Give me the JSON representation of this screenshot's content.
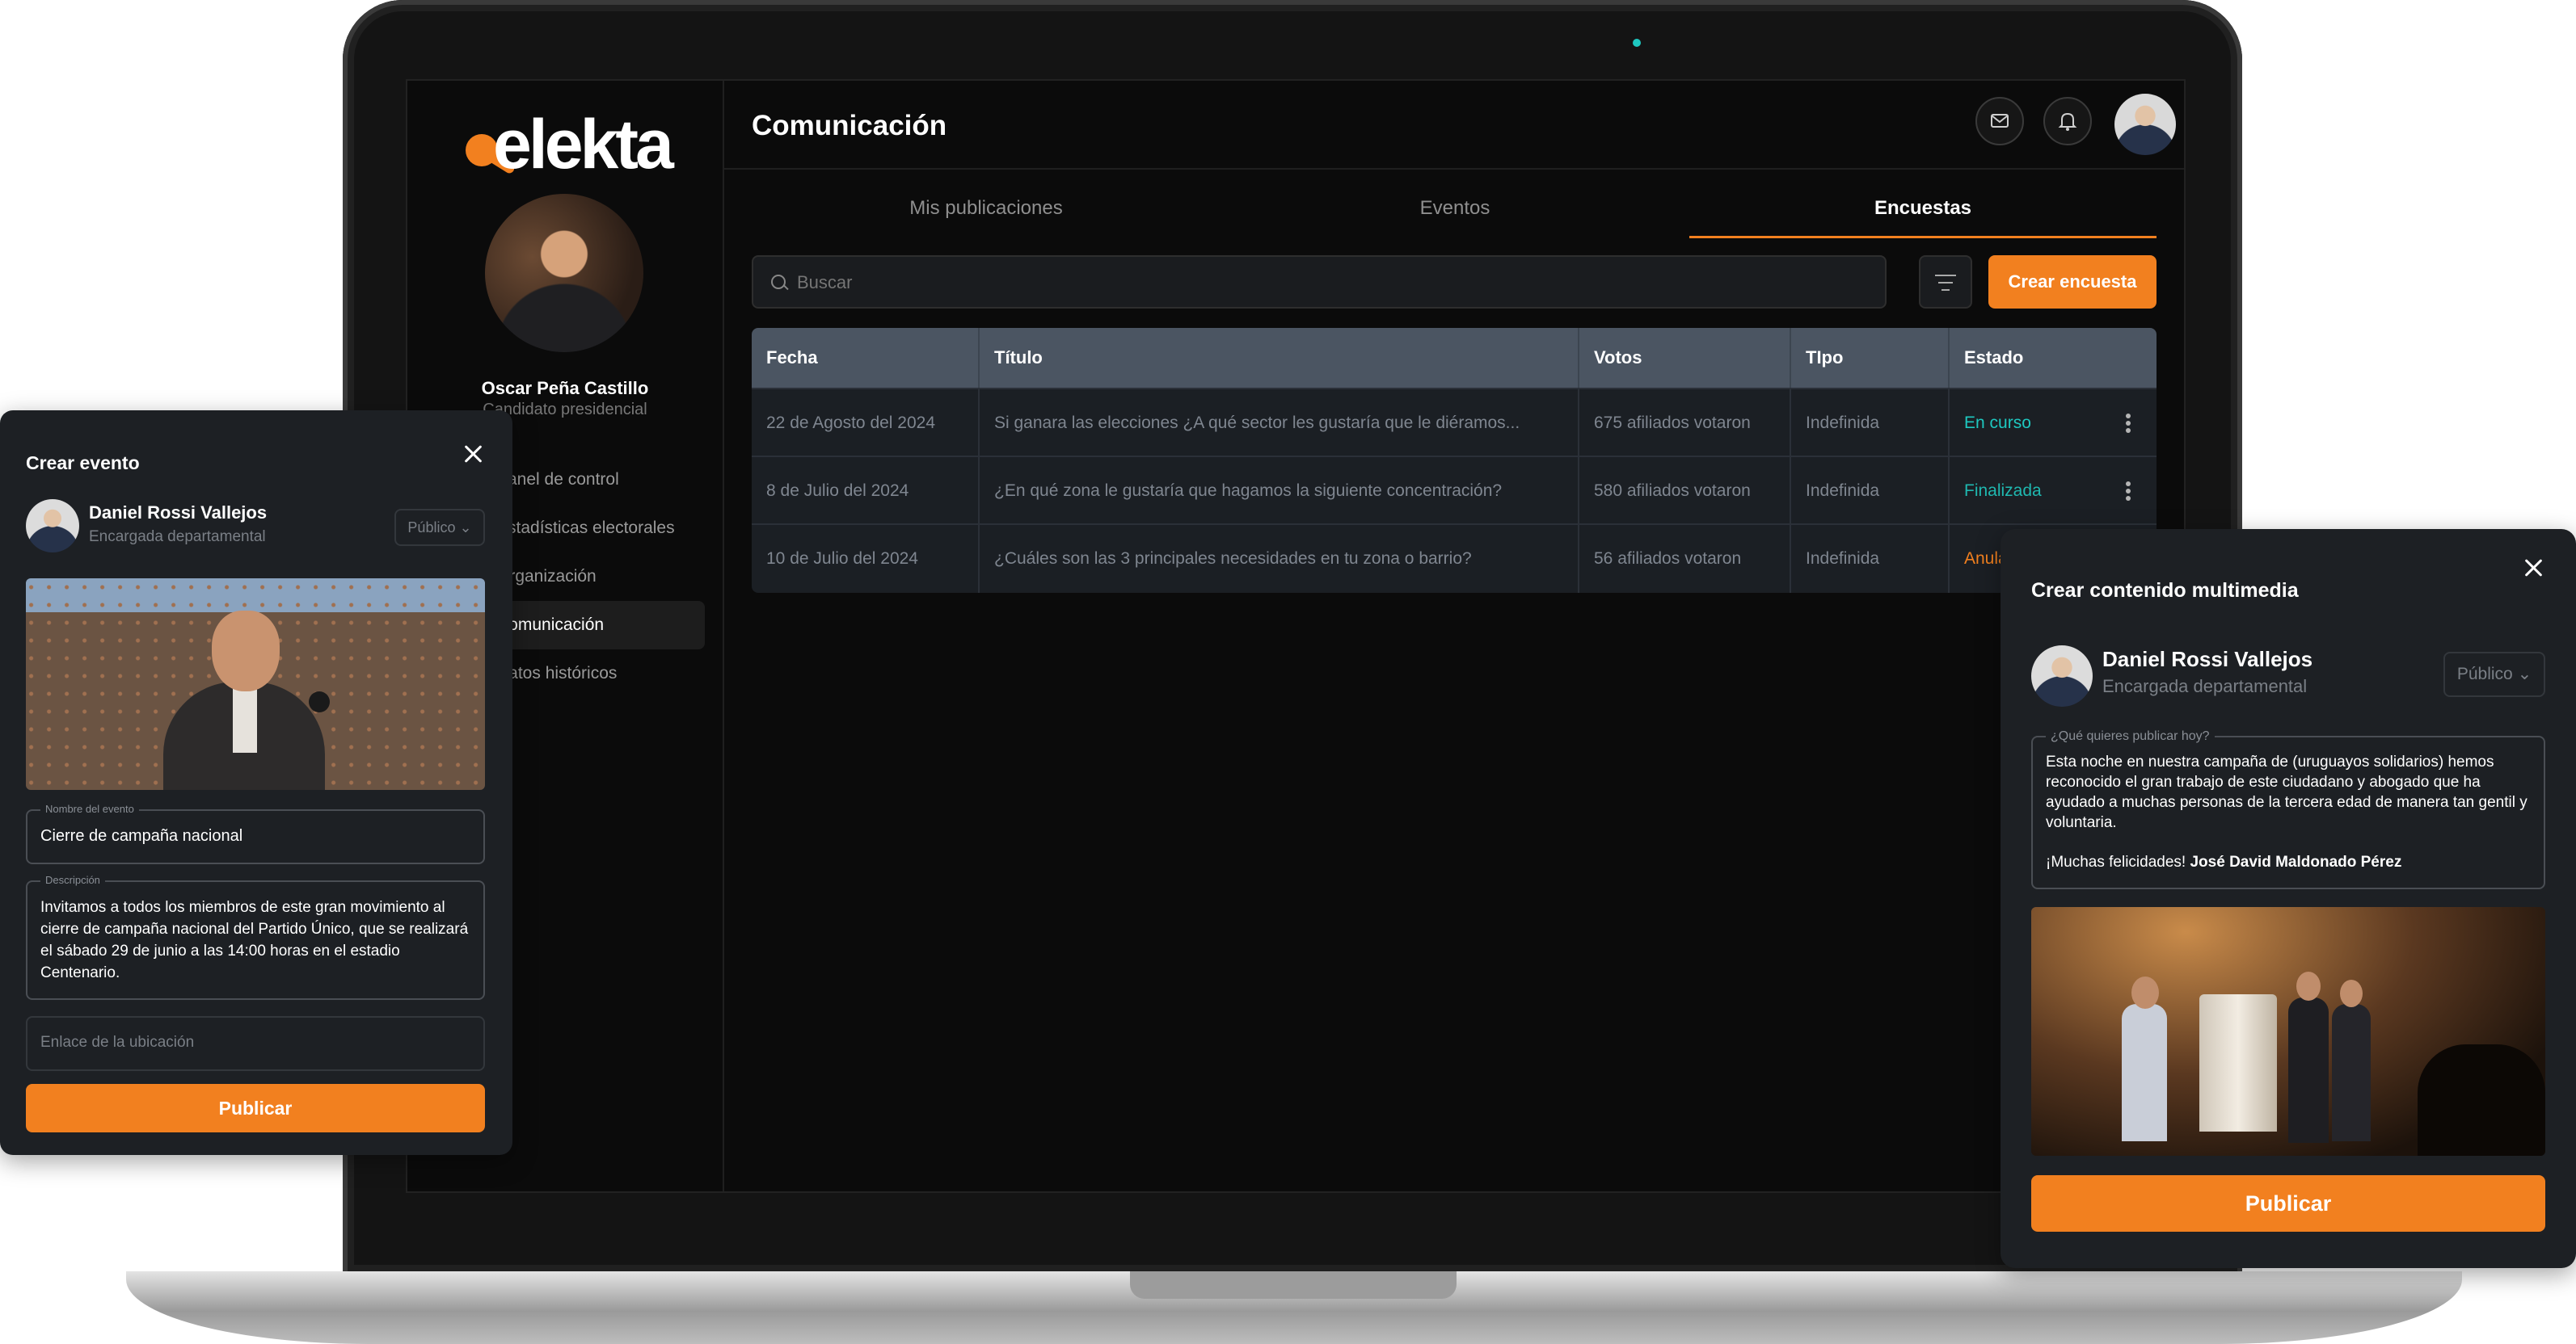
{
  "app": {
    "logo_text": "elekta",
    "page_title": "Comunicación"
  },
  "sidebar": {
    "profile_name": "Oscar Peña Castillo",
    "profile_role": "Candidato presidencial",
    "items": [
      {
        "label": "Panel de control"
      },
      {
        "label": "Estadísticas electorales"
      },
      {
        "label": "Organización"
      },
      {
        "label": "Comunicación"
      },
      {
        "label": "Datos históricos"
      }
    ]
  },
  "header_icons": [
    "mail-icon",
    "bell-icon",
    "user-avatar"
  ],
  "tabs": [
    {
      "label": "Mis publicaciones",
      "active": false
    },
    {
      "label": "Eventos",
      "active": false
    },
    {
      "label": "Encuestas",
      "active": true
    }
  ],
  "toolbar": {
    "search_placeholder": "Buscar",
    "create_label": "Crear encuesta"
  },
  "table": {
    "columns": [
      "Fecha",
      "Título",
      "Votos",
      "TIpo",
      "Estado"
    ],
    "rows": [
      {
        "fecha": "22 de Agosto del 2024",
        "titulo": "Si ganara las elecciones ¿A qué sector les gustaría que le diéramos...",
        "votos": "675 afiliados votaron",
        "tipo": "Indefinida",
        "estado": "En curso",
        "estado_color": "#1ec8c0"
      },
      {
        "fecha": "8 de Julio del 2024",
        "titulo": "¿En qué zona le gustaría que hagamos la siguiente concentración?",
        "votos": "580 afiliados votaron",
        "tipo": "Indefinida",
        "estado": "Finalizada",
        "estado_color": "#1fb8b0"
      },
      {
        "fecha": "10 de Julio del 2024",
        "titulo": "¿Cuáles son las 3 principales necesidades en tu zona o barrio?",
        "votos": "56 afiliados votaron",
        "tipo": "Indefinida",
        "estado": "Anulada",
        "estado_color": "#f2801f"
      }
    ]
  },
  "event_modal": {
    "title": "Crear evento",
    "user_name": "Daniel Rossi Vallejos",
    "user_role": "Encargada departamental",
    "privacy": "Público",
    "name_label": "Nombre del evento",
    "name_value": "Cierre de campaña nacional",
    "desc_label": "Descripción",
    "desc_value": "Invitamos a todos los miembros de este gran movimiento al cierre de campaña nacional del Partido Único, que se realizará el sábado 29 de junio a las 14:00 horas en el estadio Centenario.",
    "location_placeholder": "Enlace de la ubicación",
    "publish_label": "Publicar"
  },
  "media_modal": {
    "title": "Crear contenido multimedia",
    "user_name": "Daniel Rossi Vallejos",
    "user_role": "Encargada departamental",
    "privacy": "Público",
    "post_label": "¿Qué quieres publicar hoy?",
    "post_body": "Esta noche en nuestra campaña de (uruguayos solidarios) hemos reconocido el gran trabajo de este ciudadano y abogado que ha ayudado a muchas personas de la tercera edad de manera tan gentil y voluntaria.",
    "post_congrats": "¡Muchas felicidades!",
    "post_mention": "José David Maldonado Pérez",
    "publish_label": "Publicar"
  },
  "colors": {
    "accent": "#f2801f",
    "background": "#0b0b0b",
    "table_header": "#4b5562",
    "card": "#1d2024"
  }
}
